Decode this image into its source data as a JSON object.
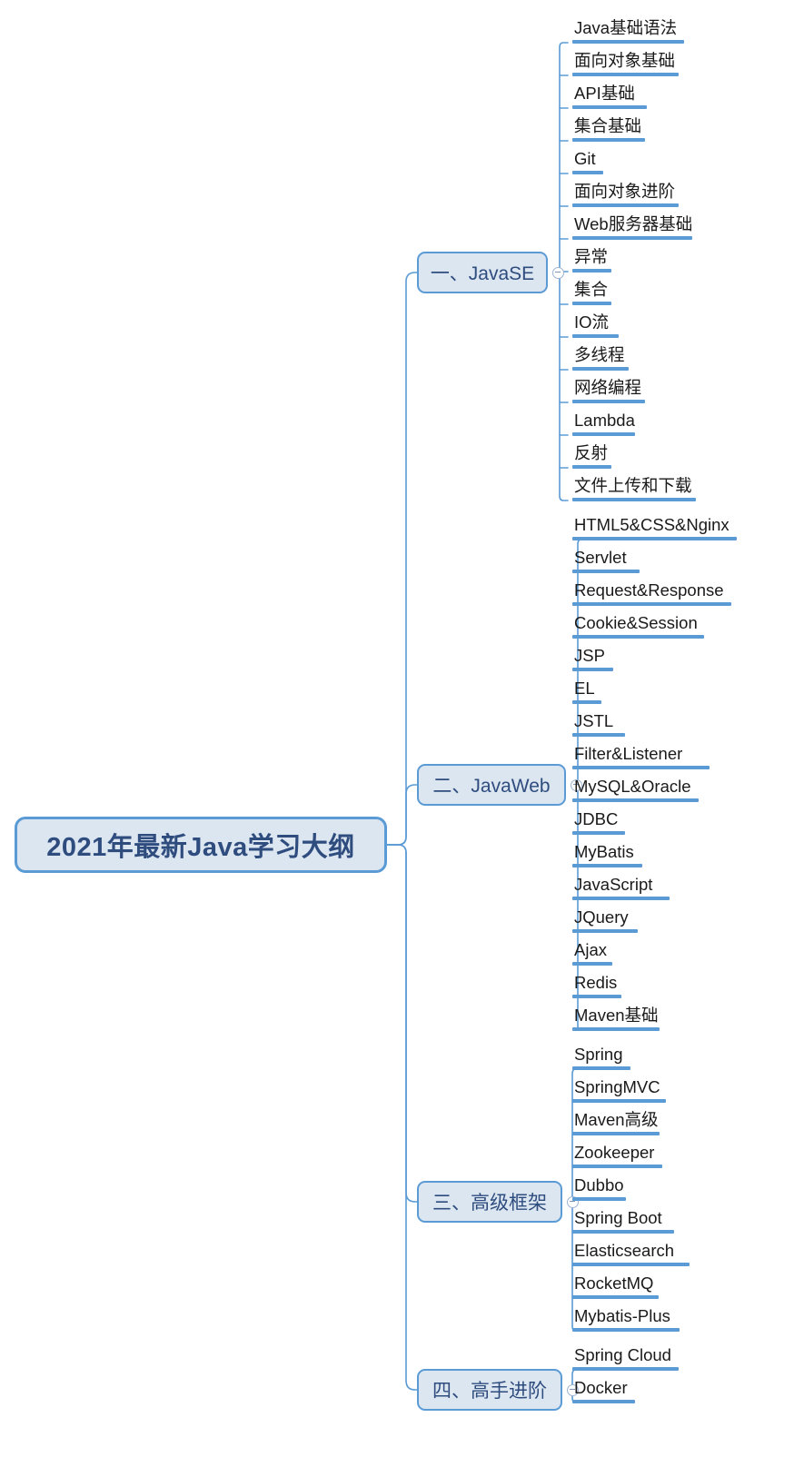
{
  "title": "2021年最新Java学习大纲",
  "colors": {
    "node_fill": "#DCE6F1",
    "node_border": "#5B9BD5",
    "node_text": "#2E4C7E",
    "connector": "#5B9BD5",
    "underline": "#5B9BD5",
    "leaf_text": "#1A1A1A",
    "background": "#FFFFFF"
  },
  "root": {
    "label": "2021年最新Java学习大纲"
  },
  "branches": [
    {
      "id": "javase",
      "label": "一、JavaSE",
      "toggle": "collapse-toggle-minus",
      "items": [
        "Java基础语法",
        "面向对象基础",
        "API基础",
        "集合基础",
        "Git",
        "面向对象进阶",
        "Web服务器基础",
        "异常",
        "集合",
        "IO流",
        "多线程",
        "网络编程",
        "Lambda",
        "反射",
        "文件上传和下载"
      ]
    },
    {
      "id": "javaweb",
      "label": "二、JavaWeb",
      "toggle": "collapse-toggle-minus",
      "items": [
        "HTML5&CSS&Nginx",
        "Servlet",
        "Request&Response",
        "Cookie&Session",
        "JSP",
        "EL",
        "JSTL",
        "Filter&Listener",
        "MySQL&Oracle",
        "JDBC",
        "MyBatis",
        "JavaScript",
        "JQuery",
        "Ajax",
        "Redis",
        "Maven基础"
      ]
    },
    {
      "id": "advanced-framework",
      "label": "三、高级框架",
      "toggle": "collapse-toggle-minus",
      "items": [
        "Spring",
        "SpringMVC",
        "Maven高级",
        "Zookeeper",
        "Dubbo",
        "Spring Boot",
        "Elasticsearch",
        "RocketMQ",
        "Mybatis-Plus"
      ]
    },
    {
      "id": "expert-advanced",
      "label": "四、高手进阶",
      "toggle": "collapse-toggle-minus",
      "items": [
        "Spring Cloud",
        "Docker"
      ]
    }
  ]
}
